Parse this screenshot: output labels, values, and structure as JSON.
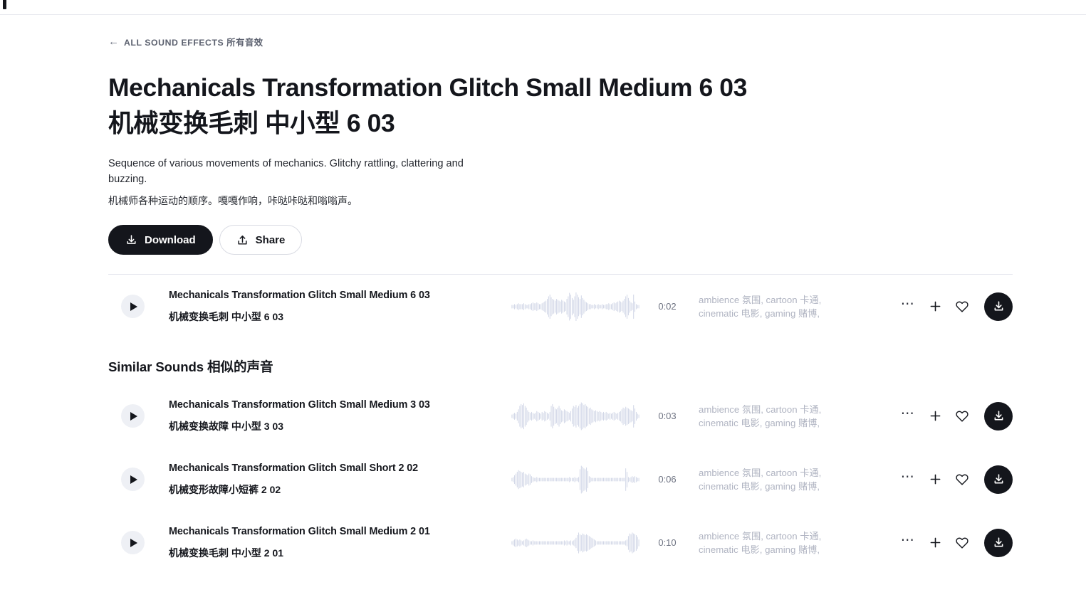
{
  "topbar": {
    "logo_icon": "logo-mark"
  },
  "breadcrumb": {
    "back_icon": "arrow-left-icon",
    "label": "ALL SOUND EFFECTS 所有音效"
  },
  "header": {
    "title_en": "Mechanicals Transformation Glitch Small Medium 6 03",
    "title_cn": "机械变换毛刺 中小型 6 03",
    "description_en": "Sequence of various movements of mechanics. Glitchy rattling, clattering and buzzing.",
    "description_cn": "机械师各种运动的顺序。嘎嘎作响，咔哒咔哒和嗡嗡声。"
  },
  "actions": {
    "download_label": "Download",
    "download_icon": "download-icon",
    "share_label": "Share",
    "share_icon": "share-upload-icon"
  },
  "main_track": {
    "play_icon": "play-icon",
    "title_en": "Mechanicals Transformation Glitch Small Medium 6 03",
    "title_cn": "机械变换毛刺 中小型 6 03",
    "waveform_icon": "audio-waveform",
    "duration": "0:02",
    "tags_line1": "ambience 氛围, cartoon 卡通,",
    "tags_line2": "cinematic 电影, gaming 赌博,",
    "more_icon": "ellipsis-icon",
    "add_icon": "plus-icon",
    "favorite_icon": "heart-outline-icon",
    "download_icon": "download-circle-icon"
  },
  "similar": {
    "heading": "Similar Sounds 相似的声音",
    "tracks": [
      {
        "play_icon": "play-icon",
        "title_en": "Mechanicals Transformation Glitch Small Medium 3 03",
        "title_cn": "机械变换故障 中小型 3 03",
        "waveform_icon": "audio-waveform",
        "duration": "0:03",
        "tags_line1": "ambience 氛围, cartoon 卡通,",
        "tags_line2": "cinematic 电影, gaming 赌博,",
        "more_icon": "ellipsis-icon",
        "add_icon": "plus-icon",
        "favorite_icon": "heart-outline-icon",
        "download_icon": "download-circle-icon"
      },
      {
        "play_icon": "play-icon",
        "title_en": "Mechanicals Transformation Glitch Small Short 2 02",
        "title_cn": "机械变形故障小短裤 2 02",
        "waveform_icon": "audio-waveform",
        "duration": "0:06",
        "tags_line1": "ambience 氛围, cartoon 卡通,",
        "tags_line2": "cinematic 电影, gaming 赌博,",
        "more_icon": "ellipsis-icon",
        "add_icon": "plus-icon",
        "favorite_icon": "heart-outline-icon",
        "download_icon": "download-circle-icon"
      },
      {
        "play_icon": "play-icon",
        "title_en": "Mechanicals Transformation Glitch Small Medium 2 01",
        "title_cn": "机械变换毛刺 中小型 2 01",
        "waveform_icon": "audio-waveform",
        "duration": "0:10",
        "tags_line1": "ambience 氛围, cartoon 卡通,",
        "tags_line2": "cinematic 电影, gaming 赌博,",
        "more_icon": "ellipsis-icon",
        "add_icon": "plus-icon",
        "favorite_icon": "heart-outline-icon",
        "download_icon": "download-circle-icon"
      }
    ]
  },
  "waveforms": {
    "main": [
      2,
      2,
      3,
      2,
      3,
      4,
      3,
      3,
      3,
      4,
      3,
      2,
      2,
      3,
      3,
      4,
      5,
      4,
      4,
      5,
      4,
      3,
      3,
      4,
      5,
      6,
      7,
      9,
      12,
      14,
      11,
      9,
      8,
      7,
      9,
      8,
      7,
      6,
      8,
      7,
      6,
      5,
      9,
      12,
      16,
      14,
      10,
      8,
      12,
      18,
      14,
      11,
      9,
      13,
      10,
      8,
      6,
      5,
      4,
      3,
      3,
      2,
      2,
      3,
      2,
      2,
      3,
      2,
      2,
      3,
      2,
      2,
      3,
      3,
      4,
      3,
      3,
      4,
      5,
      4,
      5,
      6,
      7,
      6,
      5,
      7,
      9,
      12,
      14,
      10,
      7,
      5,
      4,
      14,
      6,
      3,
      2,
      2
    ],
    "s1": [
      2,
      3,
      4,
      3,
      5,
      8,
      12,
      14,
      13,
      15,
      12,
      10,
      7,
      5,
      4,
      5,
      4,
      3,
      4,
      6,
      5,
      4,
      3,
      5,
      4,
      6,
      5,
      4,
      3,
      5,
      12,
      14,
      11,
      9,
      8,
      10,
      12,
      9,
      7,
      6,
      8,
      7,
      6,
      5,
      4,
      6,
      9,
      12,
      11,
      13,
      10,
      12,
      14,
      16,
      15,
      13,
      14,
      12,
      11,
      9,
      10,
      8,
      7,
      6,
      7,
      6,
      5,
      6,
      5,
      4,
      5,
      4,
      5,
      4,
      3,
      4,
      3,
      4,
      5,
      4,
      3,
      4,
      5,
      6,
      8,
      10,
      9,
      11,
      10,
      9,
      8,
      7,
      6,
      13,
      9,
      5,
      3,
      2
    ],
    "s2": [
      2,
      3,
      5,
      7,
      9,
      11,
      10,
      9,
      8,
      9,
      7,
      6,
      5,
      7,
      6,
      4,
      3,
      2,
      2,
      3,
      2,
      2,
      2,
      2,
      2,
      2,
      2,
      2,
      2,
      2,
      2,
      2,
      2,
      2,
      2,
      2,
      2,
      2,
      2,
      2,
      2,
      2,
      2,
      2,
      3,
      2,
      2,
      2,
      3,
      2,
      2,
      3,
      12,
      16,
      15,
      13,
      12,
      14,
      10,
      4,
      3,
      2,
      2,
      2,
      2,
      2,
      2,
      2,
      2,
      2,
      2,
      2,
      2,
      2,
      2,
      2,
      2,
      2,
      2,
      2,
      2,
      2,
      2,
      2,
      2,
      2,
      2,
      13,
      9,
      3,
      2,
      3,
      4,
      3,
      4,
      3,
      2,
      2
    ],
    "s3": [
      2,
      3,
      4,
      5,
      4,
      3,
      4,
      3,
      2,
      3,
      4,
      5,
      4,
      3,
      2,
      2,
      3,
      2,
      2,
      2,
      2,
      2,
      2,
      2,
      2,
      2,
      2,
      2,
      2,
      2,
      2,
      2,
      2,
      2,
      2,
      2,
      2,
      2,
      2,
      2,
      3,
      2,
      3,
      2,
      2,
      3,
      2,
      3,
      4,
      6,
      9,
      12,
      10,
      9,
      11,
      10,
      9,
      10,
      9,
      8,
      7,
      6,
      5,
      4,
      3,
      2,
      2,
      2,
      2,
      2,
      2,
      2,
      2,
      2,
      2,
      2,
      2,
      2,
      2,
      2,
      2,
      2,
      2,
      2,
      2,
      2,
      2,
      3,
      4,
      8,
      11,
      10,
      12,
      11,
      10,
      9,
      7,
      4
    ]
  }
}
